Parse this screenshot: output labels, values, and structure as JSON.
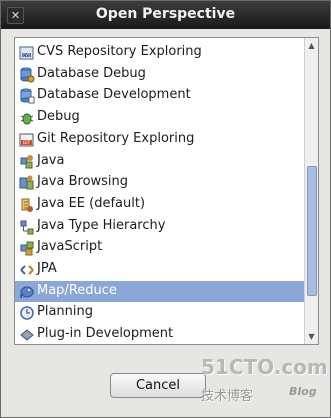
{
  "dialog": {
    "title": "Open Perspective",
    "close_glyph": "✕"
  },
  "perspectives": [
    {
      "label": "CVS Repository Exploring",
      "icon": "cvs-repository-icon",
      "selected": false
    },
    {
      "label": "Database Debug",
      "icon": "database-debug-icon",
      "selected": false
    },
    {
      "label": "Database Development",
      "icon": "database-development-icon",
      "selected": false
    },
    {
      "label": "Debug",
      "icon": "debug-bug-icon",
      "selected": false
    },
    {
      "label": "Git Repository Exploring",
      "icon": "git-repository-icon",
      "selected": false
    },
    {
      "label": "Java",
      "icon": "java-icon",
      "selected": false
    },
    {
      "label": "Java Browsing",
      "icon": "java-browsing-icon",
      "selected": false
    },
    {
      "label": "Java EE (default)",
      "icon": "java-ee-icon",
      "selected": false
    },
    {
      "label": "Java Type Hierarchy",
      "icon": "java-type-hierarchy-icon",
      "selected": false
    },
    {
      "label": "JavaScript",
      "icon": "javascript-icon",
      "selected": false
    },
    {
      "label": "JPA",
      "icon": "jpa-icon",
      "selected": false
    },
    {
      "label": "Map/Reduce",
      "icon": "map-reduce-elephant-icon",
      "selected": true
    },
    {
      "label": "Planning",
      "icon": "planning-clock-icon",
      "selected": false
    },
    {
      "label": "Plug-in Development",
      "icon": "plugin-development-icon",
      "selected": false
    }
  ],
  "buttons": {
    "cancel_label": "Cancel"
  },
  "watermark": {
    "main": "51CTO.com",
    "sub": "技术博客",
    "blog": "Blog"
  }
}
